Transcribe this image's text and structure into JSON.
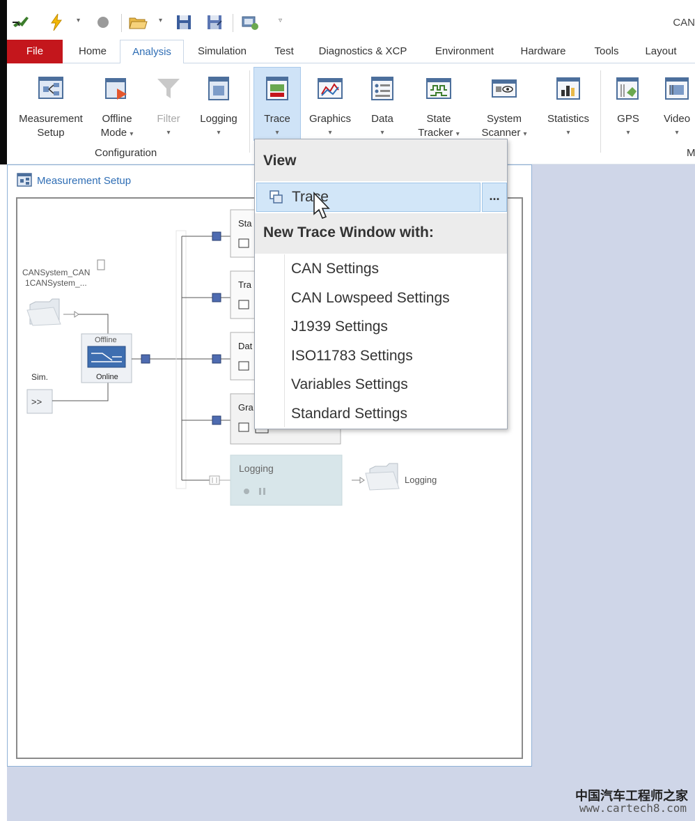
{
  "app": {
    "title": "CAN"
  },
  "quick_access": {
    "dropdown_glyph": "▾",
    "customize_glyph": "▿"
  },
  "tabs": [
    {
      "label": "File"
    },
    {
      "label": "Home"
    },
    {
      "label": "Analysis"
    },
    {
      "label": "Simulation"
    },
    {
      "label": "Test"
    },
    {
      "label": "Diagnostics & XCP"
    },
    {
      "label": "Environment"
    },
    {
      "label": "Hardware"
    },
    {
      "label": "Tools"
    },
    {
      "label": "Layout"
    }
  ],
  "ribbon": {
    "buttons": [
      {
        "line1": "Measurement",
        "line2": "Setup",
        "dd": ""
      },
      {
        "line1": "Offline",
        "line2": "Mode",
        "dd": "▾"
      },
      {
        "line1": "Filter",
        "line2": "",
        "dd": "▾"
      },
      {
        "line1": "Logging",
        "line2": "",
        "dd": "▾"
      },
      {
        "line1": "Trace",
        "line2": "",
        "dd": "▾"
      },
      {
        "line1": "Graphics",
        "line2": "",
        "dd": "▾"
      },
      {
        "line1": "Data",
        "line2": "",
        "dd": "▾"
      },
      {
        "line1": "State",
        "line2": "Tracker",
        "dd": "▾"
      },
      {
        "line1": "System",
        "line2": "Scanner",
        "dd": "▾"
      },
      {
        "line1": "Statistics",
        "line2": "",
        "dd": "▾"
      },
      {
        "line1": "GPS",
        "line2": "",
        "dd": "▾"
      },
      {
        "line1": "Video",
        "line2": "",
        "dd": "▾"
      }
    ],
    "groups": {
      "configuration": "Configuration",
      "next_group": "M"
    }
  },
  "measurement_setup": {
    "title": "Measurement Setup",
    "nodes": {
      "source_line1": "CANSystem_CAN",
      "source_line2": "1CANSystem_...",
      "sim": "Sim.",
      "sim_button": ">>",
      "switch_offline": "Offline",
      "switch_online": "Online",
      "block_stat": "Sta",
      "block_trace": "Tra",
      "block_data": "Dat",
      "block_graphics": "Gra",
      "logging_block": "Logging",
      "logging_file": "Logging"
    }
  },
  "menu": {
    "view_header": "View",
    "trace_item": "Trace",
    "more_button": "...",
    "new_header": "New Trace Window with:",
    "items": [
      {
        "label": "CAN Settings"
      },
      {
        "label": "CAN Lowspeed Settings"
      },
      {
        "label": "J1939 Settings"
      },
      {
        "label": "ISO11783 Settings"
      },
      {
        "label": "Variables Settings"
      },
      {
        "label": "Standard Settings"
      }
    ]
  },
  "watermark": {
    "cn": "中国汽车工程师之家",
    "url": "www.cartech8.com"
  },
  "colors": {
    "file_tab": "#c4161c",
    "accent": "#2f6eb5",
    "pressed": "#cfe3f7",
    "workspace": "#cfd6e8"
  }
}
